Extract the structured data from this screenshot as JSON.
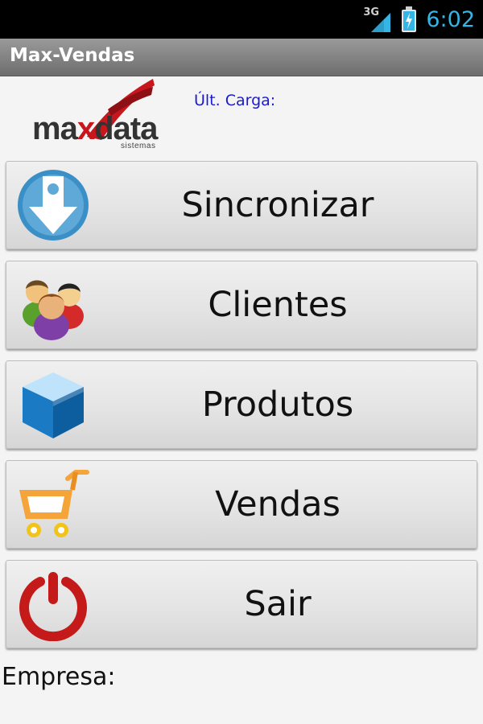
{
  "status_bar": {
    "network": "3G",
    "time": "6:02",
    "icons": [
      "signal-icon",
      "battery-charging-icon"
    ]
  },
  "app": {
    "title": "Max-Vendas"
  },
  "logo": {
    "brand_prefix": "ma",
    "brand_x": "x",
    "brand_suffix": "data",
    "subtitle": "sistemas",
    "accent": "#c8161d"
  },
  "header": {
    "ultima_carga_label": "Últ. Carga:"
  },
  "menu": {
    "items": [
      {
        "label": "Sincronizar",
        "icon": "download-icon"
      },
      {
        "label": "Clientes",
        "icon": "users-icon"
      },
      {
        "label": "Produtos",
        "icon": "box-icon"
      },
      {
        "label": "Vendas",
        "icon": "cart-icon"
      },
      {
        "label": "Sair",
        "icon": "power-icon"
      }
    ]
  },
  "footer": {
    "empresa_label": "Empresa:"
  }
}
